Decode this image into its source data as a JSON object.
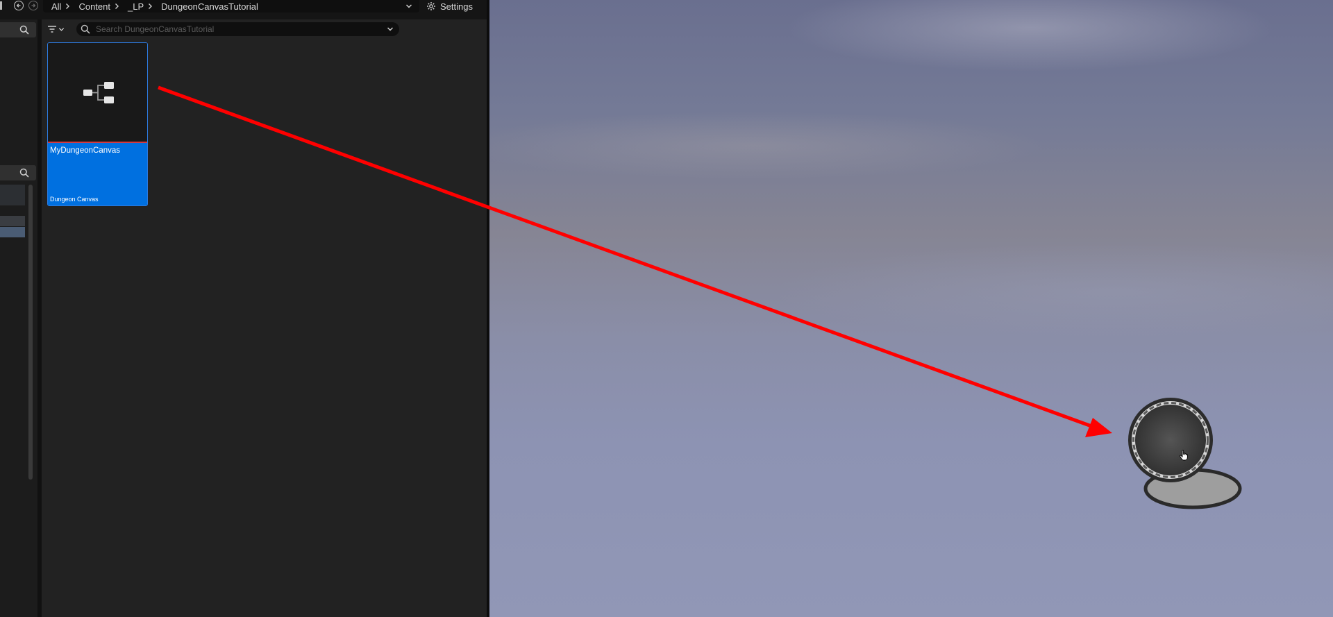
{
  "toolbar": {
    "back_icon": "circle-arrow-left-icon",
    "forward_icon": "circle-arrow-right-icon",
    "breadcrumbs": [
      "All",
      "Content",
      "_LP",
      "DungeonCanvasTutorial"
    ],
    "settings_label": "Settings",
    "settings_icon": "gear-icon"
  },
  "search": {
    "placeholder": "Search DungeonCanvasTutorial",
    "value": ""
  },
  "asset": {
    "name": "MyDungeonCanvas",
    "type": "Dungeon Canvas",
    "thumbnail_icon": "node-graph-icon"
  },
  "colors": {
    "selection": "#0070e0",
    "annotation": "#ff0000",
    "panel": "#222222"
  },
  "viewport": {
    "actor_icon": "dungeon-canvas-actor-icon",
    "cursor": "hand-pointer-icon"
  }
}
